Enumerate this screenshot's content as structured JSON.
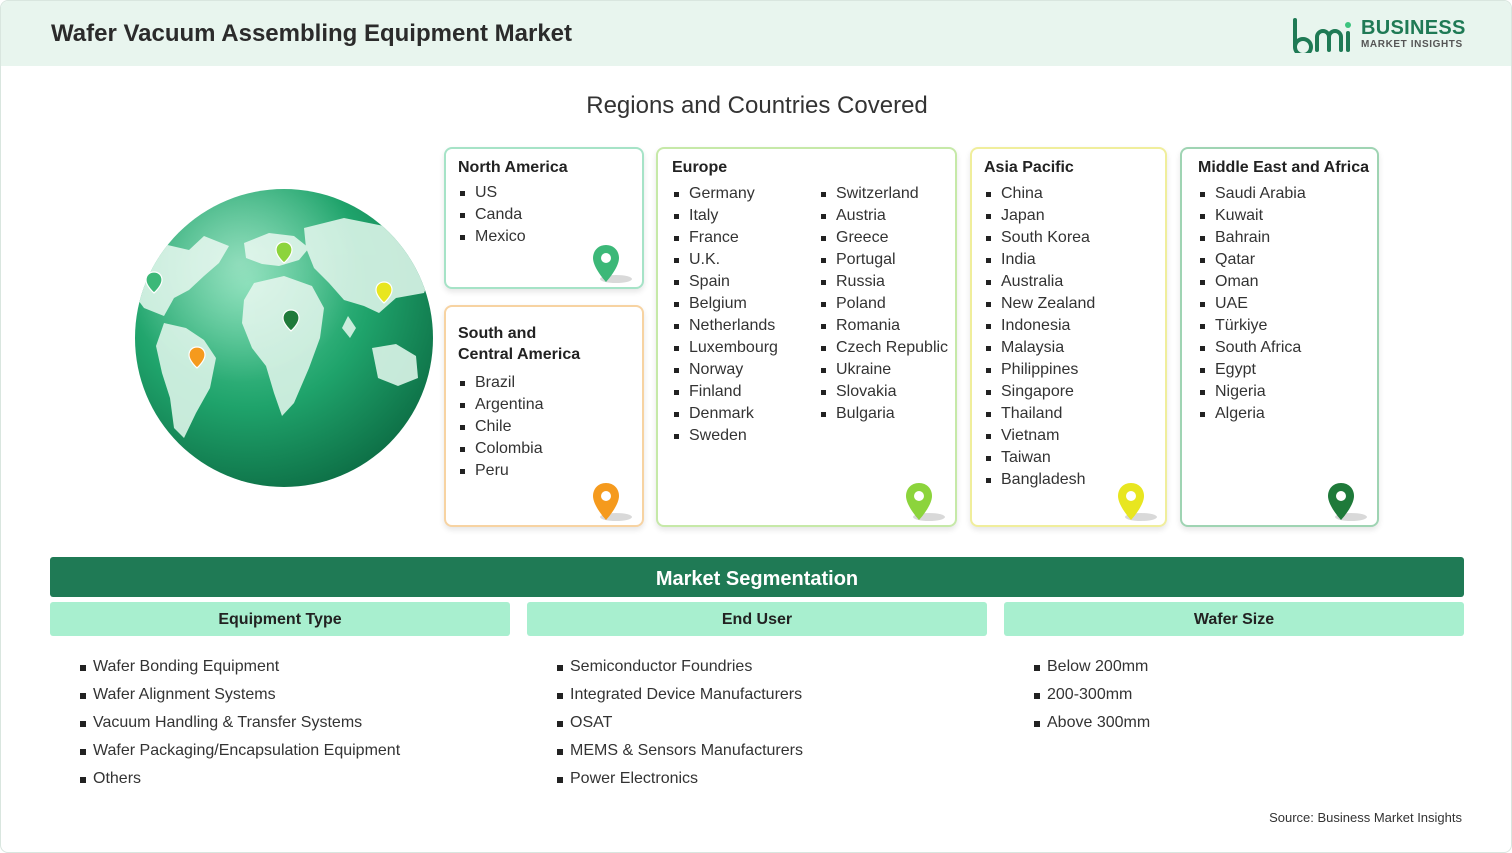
{
  "header": {
    "title": "Wafer Vacuum Assembling Equipment Market",
    "logo": {
      "brand_line1": "BUSINESS",
      "brand_line2": "MARKET INSIGHTS",
      "mark_icon": "bmi-logo-icon"
    }
  },
  "regions": {
    "title": "Regions and Countries Covered",
    "north_america": {
      "name": "North America",
      "countries": [
        "US",
        "Canda",
        "Mexico"
      ],
      "pin_color": "#3cb878"
    },
    "south_central_america": {
      "name_line1": "South and",
      "name_line2": "Central America",
      "countries": [
        "Brazil",
        "Argentina",
        "Chile",
        "Colombia",
        "Peru"
      ],
      "pin_color": "#f59a1d"
    },
    "europe": {
      "name": "Europe",
      "countries_col1": [
        "Germany",
        "Italy",
        "France",
        "U.K.",
        "Spain",
        "Belgium",
        "Netherlands",
        "Luxembourg",
        "Norway",
        "Finland",
        "Denmark",
        "Sweden"
      ],
      "countries_col2": [
        "Switzerland",
        "Austria",
        "Greece",
        "Portugal",
        "Russia",
        "Poland",
        "Romania",
        "Czech Republic",
        "Ukraine",
        "Slovakia",
        "Bulgaria"
      ],
      "pin_color": "#8cd43c"
    },
    "asia_pacific": {
      "name": "Asia Pacific",
      "countries": [
        "China",
        "Japan",
        "South Korea",
        "India",
        "Australia",
        "New Zealand",
        "Indonesia",
        "Malaysia",
        "Philippines",
        "Singapore",
        "Thailand",
        "Vietnam",
        "Taiwan",
        "Bangladesh"
      ],
      "pin_color": "#e8e620"
    },
    "middle_east_africa": {
      "name": "Middle East and Africa",
      "countries": [
        "Saudi Arabia",
        "Kuwait",
        "Bahrain",
        "Qatar",
        "Oman",
        "UAE",
        "Türkiye",
        "South Africa",
        "Egypt",
        "Nigeria",
        "Algeria"
      ],
      "pin_color": "#1f7a3a"
    }
  },
  "segmentation": {
    "title": "Market Segmentation",
    "equipment_type": {
      "label": "Equipment Type",
      "items": [
        "Wafer Bonding Equipment",
        "Wafer Alignment Systems",
        "Vacuum Handling & Transfer Systems",
        "Wafer Packaging/Encapsulation Equipment",
        "Others"
      ]
    },
    "end_user": {
      "label": "End User",
      "items": [
        "Semiconductor Foundries",
        "Integrated Device Manufacturers",
        "OSAT",
        "MEMS & Sensors Manufacturers",
        "Power Electronics"
      ]
    },
    "wafer_size": {
      "label": "Wafer Size",
      "items": [
        "Below 200mm",
        "200-300mm",
        "Above 300mm"
      ]
    }
  },
  "source": "Source: Business Market Insights",
  "colors": {
    "brand_green": "#1f7a55",
    "header_bg": "#e8f5ee",
    "segment_head_bg": "#a8efcf"
  }
}
